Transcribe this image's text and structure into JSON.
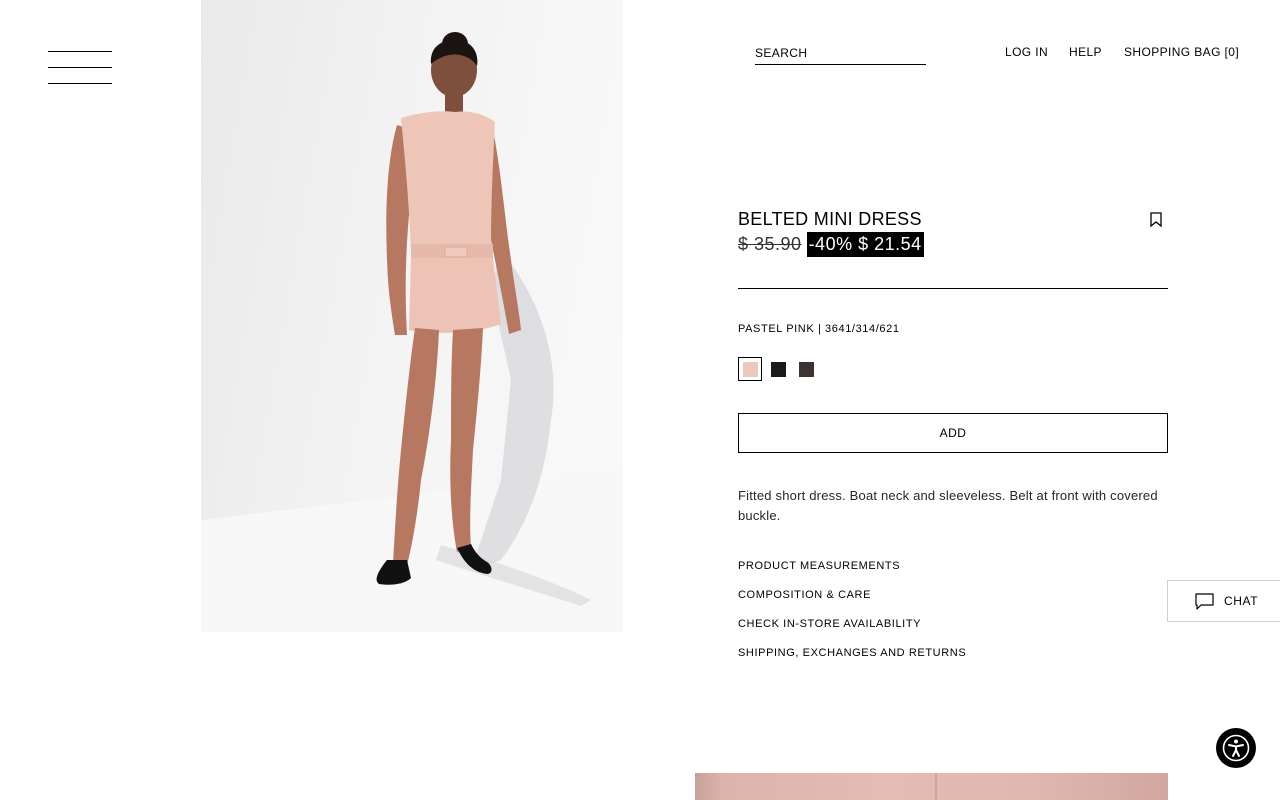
{
  "header": {
    "menu_icon": "hamburger-menu-icon",
    "search_placeholder": "SEARCH",
    "login_label": "LOG IN",
    "help_label": "HELP",
    "bag_label": "SHOPPING BAG [0]"
  },
  "product": {
    "image_alt": "pastel-pink-mini-dress-photo",
    "name": "BELTED MINI DRESS",
    "bookmark_icon": "bookmark-icon",
    "original_price": "$ 35.90",
    "discount": "-40%",
    "sale_price": "$ 21.54",
    "color_info": "PASTEL PINK | 3641/314/621",
    "swatches": [
      {
        "color": "#ecc8bd",
        "selected": true
      },
      {
        "color": "#1a1a1a",
        "selected": false
      },
      {
        "color": "#3e3232",
        "selected": false
      }
    ],
    "add_label": "ADD",
    "description": "Fitted short dress. Boat neck and sleeveless. Belt at front with covered buckle.",
    "info_links": [
      "PRODUCT MEASUREMENTS",
      "COMPOSITION & CARE",
      "CHECK IN-STORE AVAILABILITY",
      "SHIPPING, EXCHANGES AND RETURNS"
    ]
  },
  "chat": {
    "label": "CHAT",
    "icon": "chat-bubble-icon"
  },
  "accessibility": {
    "icon": "accessibility-icon"
  },
  "colors": {
    "text": "#000000",
    "sale_bg": "#000000",
    "sale_text": "#ffffff",
    "dress_pink": "#ecc8bd"
  }
}
